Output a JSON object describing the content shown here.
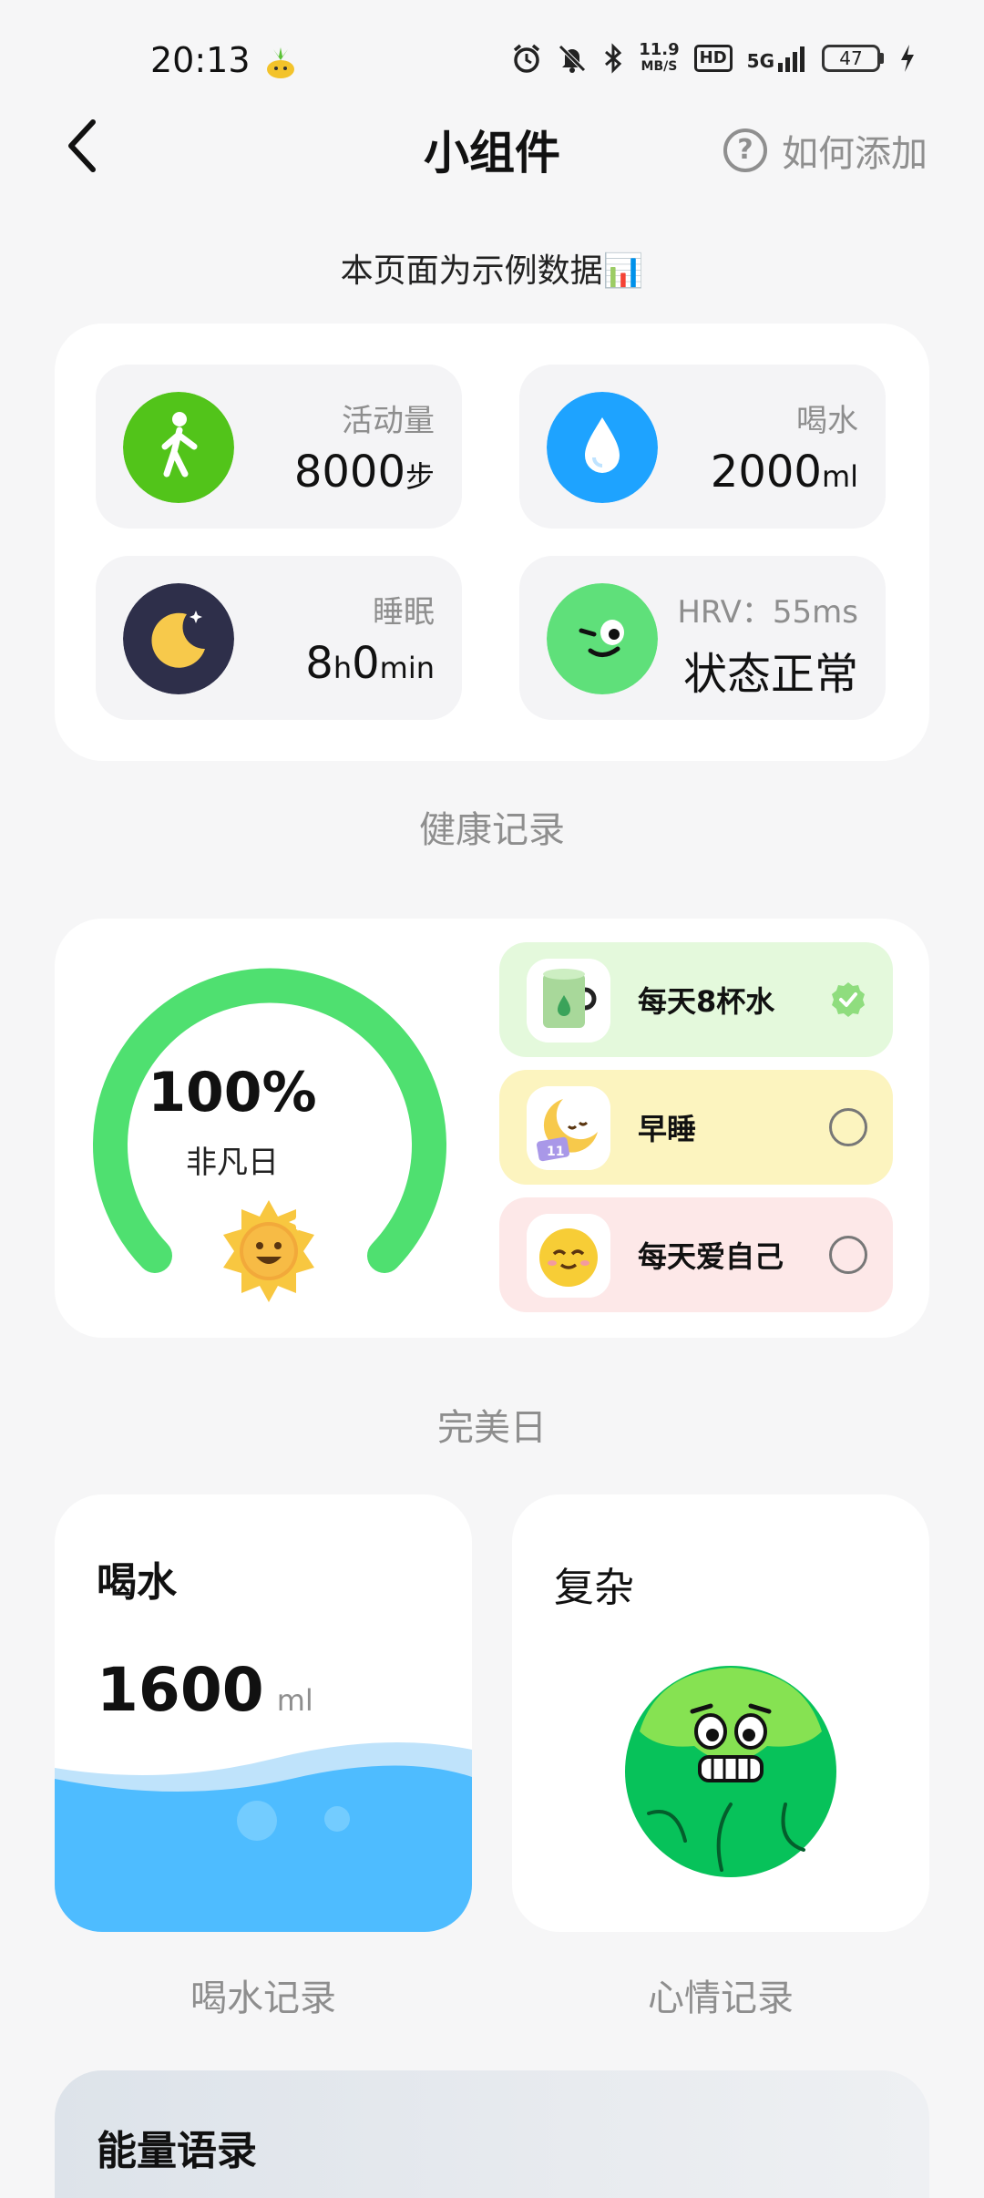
{
  "status_bar": {
    "time": "20:13",
    "net_speed_value": "11.9",
    "net_speed_unit": "MB/S",
    "hd": "HD",
    "signal": "5G",
    "battery": "47"
  },
  "header": {
    "title": "小组件",
    "help_label": "如何添加",
    "help_icon": "?"
  },
  "sample_note": "本页面为示例数据📊",
  "health": {
    "tiles": [
      {
        "label": "活动量",
        "value": "8000",
        "unit": "步"
      },
      {
        "label": "喝水",
        "value": "2000",
        "unit": "ml"
      },
      {
        "label": "睡眠",
        "value_parts": [
          "8",
          "h",
          "0",
          "min"
        ]
      },
      {
        "label": "HRV：55ms",
        "value": "状态正常"
      }
    ],
    "caption": "健康记录"
  },
  "perfect_day": {
    "percent": "100%",
    "subtitle": "非凡日",
    "progress": 1.0,
    "habits": [
      {
        "label": "每天8杯水",
        "done": true,
        "color": "#e4f9dc"
      },
      {
        "label": "早睡",
        "done": false,
        "color": "#fcf4bf"
      },
      {
        "label": "每天爱自己",
        "done": false,
        "color": "#fde8e8"
      }
    ],
    "caption": "完美日"
  },
  "water": {
    "title": "喝水",
    "amount": "1600",
    "unit": "ml",
    "caption": "喝水记录"
  },
  "mood": {
    "title": "复杂",
    "caption": "心情记录"
  },
  "energy": {
    "title": "能量语录"
  },
  "colors": {
    "activity": "#52c41a",
    "water": "#1ea3ff",
    "sleep": "#2e2f4a",
    "hrv": "#5fe07a",
    "ring": "#4fe070",
    "water_fill": "#4ebcff"
  }
}
